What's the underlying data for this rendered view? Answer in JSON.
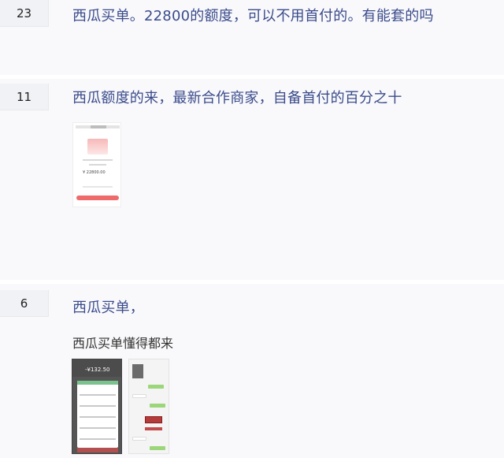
{
  "posts": [
    {
      "reply_count": "23",
      "title": "西瓜买单。22800的额度，可以不用首付的。有能套的吗"
    },
    {
      "reply_count": "11",
      "title": "西瓜额度的来，最新合作商家，自备首付的百分之十",
      "thumbnail": {
        "amount": "¥ 22800.00"
      }
    },
    {
      "reply_count": "6",
      "title": "西瓜买单，",
      "body": "西瓜买单懂得都来",
      "thumbnail": {
        "amount": "-¥132.50"
      }
    }
  ],
  "colors": {
    "title": "#3a4b8c",
    "badge_bg": "#f0f2f5",
    "post_bg": "#f9f9fb",
    "accent_red": "#ef6b6b"
  }
}
